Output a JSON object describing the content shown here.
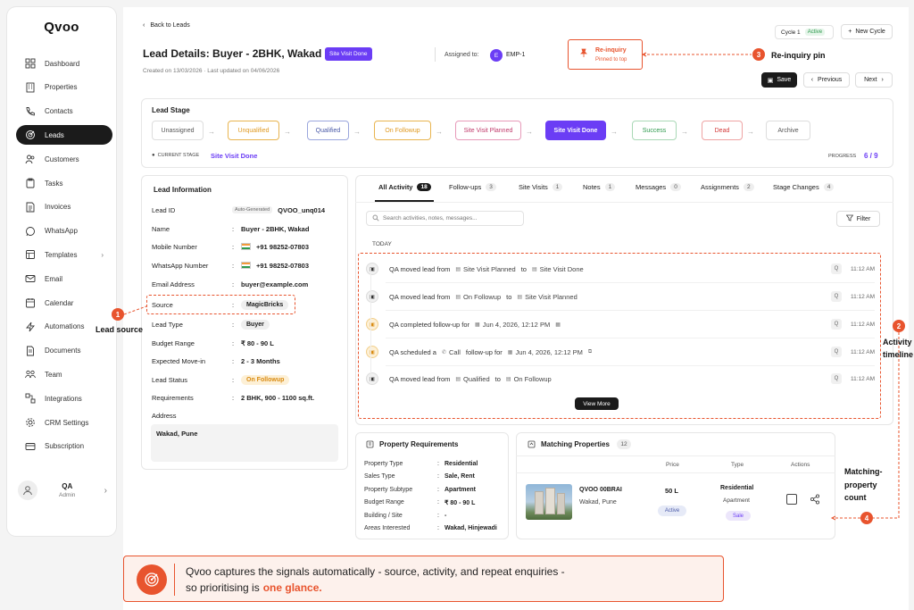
{
  "app": {
    "logo": "Qvoo"
  },
  "sidebar": {
    "items": [
      {
        "label": "Dashboard",
        "icon": "dashboard-icon"
      },
      {
        "label": "Properties",
        "icon": "building-icon"
      },
      {
        "label": "Contacts",
        "icon": "phone-icon"
      },
      {
        "label": "Leads",
        "icon": "target-icon",
        "active": true
      },
      {
        "label": "Customers",
        "icon": "users-icon"
      },
      {
        "label": "Tasks",
        "icon": "clipboard-icon"
      },
      {
        "label": "Invoices",
        "icon": "invoice-icon"
      },
      {
        "label": "WhatsApp",
        "icon": "whatsapp-icon"
      },
      {
        "label": "Templates",
        "icon": "template-icon",
        "chevron": "›"
      },
      {
        "label": "Email",
        "icon": "mail-icon"
      },
      {
        "label": "Calendar",
        "icon": "calendar-icon"
      },
      {
        "label": "Automations",
        "icon": "bolt-icon"
      },
      {
        "label": "Documents",
        "icon": "document-icon"
      },
      {
        "label": "Team",
        "icon": "team-icon"
      },
      {
        "label": "Integrations",
        "icon": "integration-icon"
      },
      {
        "label": "CRM Settings",
        "icon": "gear-icon"
      },
      {
        "label": "Subscription",
        "icon": "card-icon"
      }
    ],
    "user": {
      "name": "QA",
      "role": "Admin",
      "chevron": "›"
    }
  },
  "header": {
    "back": "Back to Leads",
    "title": "Lead Details: Buyer - 2BHK, Wakad",
    "status_badge": "Site Visit Done",
    "created": "Created on 13/03/2026 · Last updated on 04/06/2026",
    "assigned_label": "Assigned to:",
    "assignee_initial": "E",
    "assignee": "EMP-1",
    "reinquiry": {
      "title": "Re-inquiry",
      "subtitle": "Pinned to top"
    },
    "cycle": "Cycle 1",
    "cycle_status": "Active",
    "new_cycle": "New Cycle",
    "save": "Save",
    "previous": "Previous",
    "next": "Next"
  },
  "lead_stage": {
    "title": "Lead Stage",
    "stages": [
      "Unassigned",
      "Unqualified",
      "Qualified",
      "On Followup",
      "Site Visit Planned",
      "Site Visit Done",
      "Success",
      "Dead",
      "Archive"
    ],
    "current_label": "CURRENT STAGE",
    "current": "Site Visit Done",
    "progress_label": "PROGRESS",
    "progress": "6 / 9"
  },
  "lead_info": {
    "title": "Lead Information",
    "fields": [
      {
        "label": "Lead ID",
        "badge": "Auto-Generated",
        "value": "QVOO_unq014"
      },
      {
        "label": "Name",
        "value": "Buyer - 2BHK, Wakad"
      },
      {
        "label": "Mobile Number",
        "value": "+91 98252-07803"
      },
      {
        "label": "WhatsApp Number",
        "value": "+91 98252-07803"
      },
      {
        "label": "Email Address",
        "value": "buyer@example.com"
      },
      {
        "label": "Source",
        "value": "MagicBricks"
      },
      {
        "label": "Lead Type",
        "value": "Buyer"
      },
      {
        "label": "Budget Range",
        "value": "₹ 80 - 90 L"
      },
      {
        "label": "Expected Move-in",
        "value": "2 - 3 Months"
      },
      {
        "label": "Lead Status",
        "value": "On Followup"
      },
      {
        "label": "Requirements",
        "value": "2 BHK, 900 - 1100 sq.ft."
      }
    ],
    "address_label": "Address",
    "address": "Wakad, Pune"
  },
  "activity": {
    "tabs": [
      {
        "label": "All Activity",
        "count": "18"
      },
      {
        "label": "Follow-ups",
        "count": "3"
      },
      {
        "label": "Site Visits",
        "count": "1"
      },
      {
        "label": "Notes",
        "count": "1"
      },
      {
        "label": "Messages",
        "count": "0"
      },
      {
        "label": "Assignments",
        "count": "2"
      },
      {
        "label": "Stage Changes",
        "count": "4"
      }
    ],
    "search_placeholder": "Search activities, notes, messages...",
    "filter": "Filter",
    "day": "TODAY",
    "items": [
      {
        "a": "QA moved lead from",
        "b": "Site Visit Planned",
        "c": "to",
        "d": "Site Visit Done",
        "time": "11:12 AM"
      },
      {
        "a": "QA moved lead from",
        "b": "On Followup",
        "c": "to",
        "d": "Site Visit Planned",
        "time": "11:12 AM"
      },
      {
        "a": "QA completed follow-up for",
        "b": "Jun 4, 2026, 12:12 PM",
        "c": "",
        "d": "",
        "time": "11:12 AM"
      },
      {
        "a": "QA scheduled a",
        "b": "Call",
        "c": "follow-up for",
        "d": "Jun 4, 2026, 12:12 PM",
        "time": "11:12 AM"
      },
      {
        "a": "QA moved lead from",
        "b": "Qualified",
        "c": "to",
        "d": "On Followup",
        "time": "11:12 AM"
      }
    ],
    "avatar": "Q",
    "view_more": "View More"
  },
  "property_req": {
    "title": "Property Requirements",
    "rows": [
      {
        "k": "Property Type",
        "v": "Residential"
      },
      {
        "k": "Sales Type",
        "v": "Sale, Rent"
      },
      {
        "k": "Property Subtype",
        "v": "Apartment"
      },
      {
        "k": "Budget Range",
        "v": "₹ 80 - 90 L"
      },
      {
        "k": "Building / Site",
        "v": "-"
      },
      {
        "k": "Areas Interested",
        "v": "Wakad, Hinjewadi"
      }
    ]
  },
  "matching": {
    "title": "Matching Properties",
    "count": "12",
    "cols": [
      "Price",
      "Type",
      "Actions"
    ],
    "item": {
      "name": "QVOO 00BRAI",
      "location": "Wakad, Pune",
      "price": "50 L",
      "status": "Active",
      "type": "Residential",
      "subtype": "Apartment",
      "deal": "Sale"
    }
  },
  "annotations": {
    "lead_source": "Lead source",
    "activity": "Activity",
    "timeline": "timeline",
    "reinquiry": "Re-inquiry pin",
    "matching": [
      "Matching-",
      "property",
      "count"
    ],
    "n1": "1",
    "n2": "2",
    "n3": "3",
    "n4": "4"
  },
  "banner": {
    "line1": "Qvoo captures the signals automatically - source, activity, and repeat enquiries -",
    "line2": "so prioritising is",
    "highlight": "one glance."
  },
  "colors": {
    "accent": "#e8542e",
    "purple": "#6b3df5",
    "dark": "#1b1b1b"
  }
}
